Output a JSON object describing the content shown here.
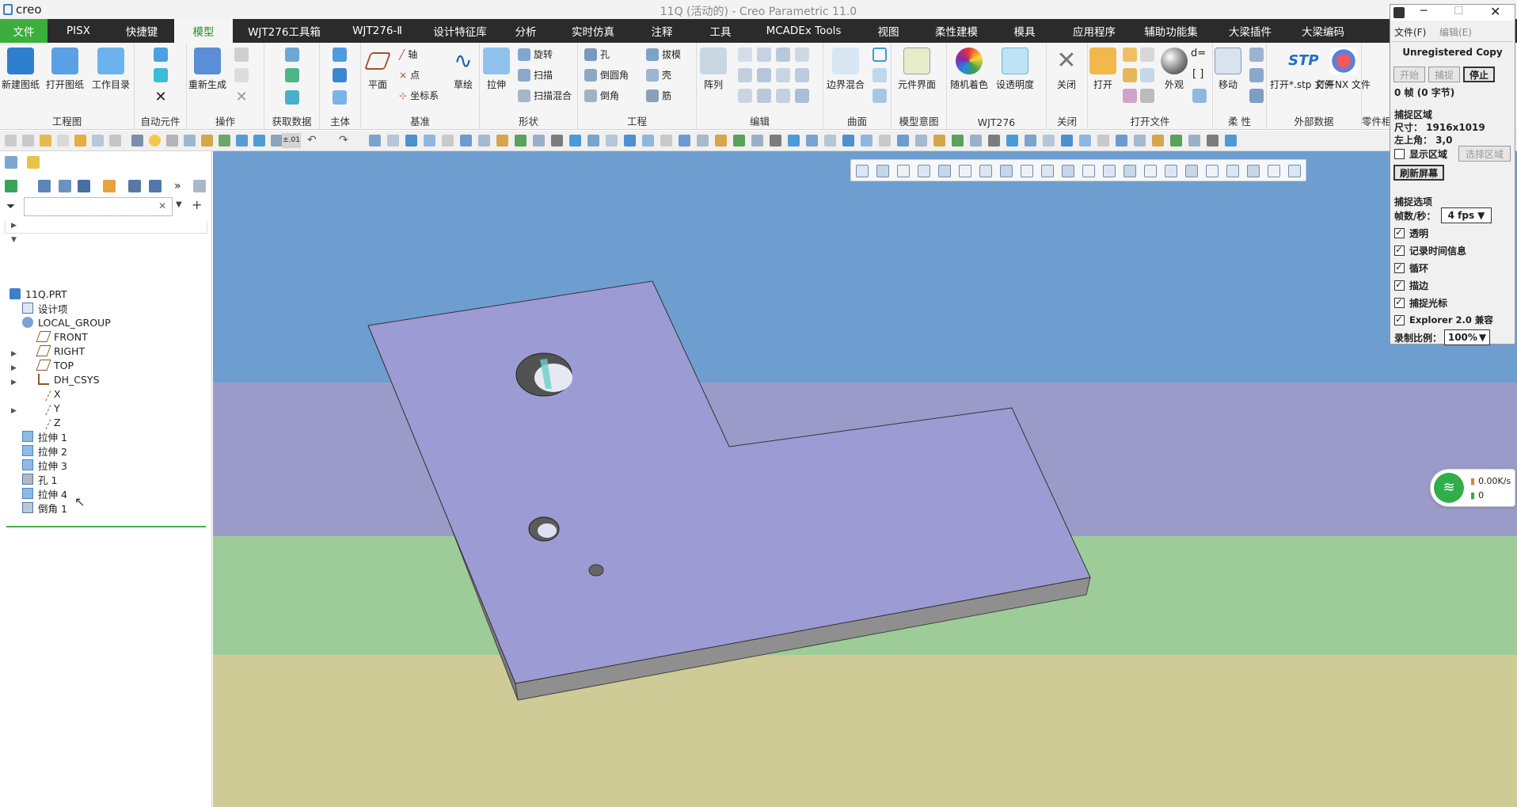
{
  "window": {
    "app_name": "creo",
    "title": "11Q (活动的) - Creo Parametric 11.0"
  },
  "colors": {
    "accent_green": "#3cae3c",
    "menubar": "#2b2b2b",
    "sky_blue": "#6d9ecf",
    "lavender": "#9b9bca",
    "band_green": "#9dcc99",
    "band_khaki": "#cfcb96",
    "part_face": "#9c9bd3"
  },
  "menu": [
    "文件",
    "PISX",
    "快捷键",
    "模型",
    "WJT276工具箱",
    "WJT276-Ⅱ",
    "设计特征库",
    "分析",
    "实时仿真",
    "注释",
    "工具",
    "MCADEx Tools",
    "视图",
    "柔性建模",
    "模具",
    "应用程序",
    "辅助功能集",
    "大梁插件",
    "大梁编码"
  ],
  "menu_active": "模型",
  "ribbon": {
    "groups": {
      "drawing": "工程图",
      "auto": "自动元件",
      "ops": "操作",
      "getdata": "获取数据",
      "body": "主体",
      "datum": "基准",
      "shape": "形状",
      "eng": "工程",
      "edit": "编辑",
      "surface": "曲面",
      "intent": "模型意图",
      "wjt": "WJT276",
      "close": "关闭",
      "openfile": "打开文件",
      "flex": "柔 性",
      "external": "外部数据",
      "part": "零件相"
    },
    "buttons": {
      "new_drawing": "新建图纸",
      "open_drawing": "打开图纸",
      "workdir": "工作目录",
      "regen": "重新生成",
      "plane": "平面",
      "axis": "轴",
      "point": "点",
      "csys": "坐标系",
      "sketch": "草绘",
      "extrude": "拉伸",
      "revolve": "旋转",
      "sweep": "扫描",
      "sweep_blend": "扫描混合",
      "hole": "孔",
      "round": "倒圆角",
      "chamfer": "倒角",
      "draft": "拔模",
      "shell": "壳",
      "rib": "筋",
      "pattern": "阵列",
      "boundary_blend": "边界混合",
      "comp_interface": "元件界面",
      "random_color": "随机着色",
      "transparency": "设透明度",
      "close": "关闭",
      "open": "打开",
      "appearance": "外观",
      "move": "移动",
      "open_stp": "打开*.stp 文件",
      "open_nx": "打开NX 文件",
      "stp_label": "STP",
      "d_equals": "d=",
      "brackets": "[ ]"
    }
  },
  "qat_label": "±.01",
  "model_tree": {
    "search": {
      "value": "",
      "placeholder": ""
    },
    "items": [
      {
        "label": "11Q.PRT",
        "icon": "part-icon"
      },
      {
        "label": "设计项",
        "icon": "design-items-icon"
      },
      {
        "label": "LOCAL_GROUP",
        "icon": "group-icon"
      },
      {
        "label": "FRONT",
        "icon": "datum-plane-icon"
      },
      {
        "label": "RIGHT",
        "icon": "datum-plane-icon"
      },
      {
        "label": "TOP",
        "icon": "datum-plane-icon"
      },
      {
        "label": "DH_CSYS",
        "icon": "csys-icon"
      },
      {
        "label": "X",
        "icon": "datum-axis-icon"
      },
      {
        "label": "Y",
        "icon": "datum-axis-icon"
      },
      {
        "label": "Z",
        "icon": "datum-axis-icon"
      },
      {
        "label": "拉伸 1",
        "icon": "extrude-icon"
      },
      {
        "label": "拉伸 2",
        "icon": "extrude-icon"
      },
      {
        "label": "拉伸 3",
        "icon": "extrude-icon"
      },
      {
        "label": "孔 1",
        "icon": "hole-icon"
      },
      {
        "label": "拉伸 4",
        "icon": "extrude-icon"
      },
      {
        "label": "倒角 1",
        "icon": "chamfer-icon"
      }
    ]
  },
  "capture": {
    "menu_file": "文件(F)",
    "menu_edit": "编辑(E)",
    "unregistered": "Unregistered Copy",
    "btn_start": "开始",
    "btn_capture": "捕捉",
    "btn_stop": "停止",
    "frames": "0 帧 (0 字节)",
    "section_area": "捕捉区域",
    "size": "尺寸： 1916x1019",
    "topleft": "左上角： 3,0",
    "show_area": "显示区域",
    "select_area": "选择区域",
    "refresh": "刷新屏幕",
    "section_options": "捕捉选项",
    "fps_label": "帧数/秒：",
    "fps_value": "4 fps",
    "opt_transparent": "透明",
    "opt_timeinfo": "记录时间信息",
    "opt_loop": "循环",
    "opt_border": "描边",
    "opt_cursor": "捕捉光标",
    "opt_explorer": "Explorer 2.0 兼容",
    "scale_label": "录制比例：",
    "scale_value": "100%"
  },
  "network": {
    "speed": "0.00K/s",
    "count": "0"
  }
}
